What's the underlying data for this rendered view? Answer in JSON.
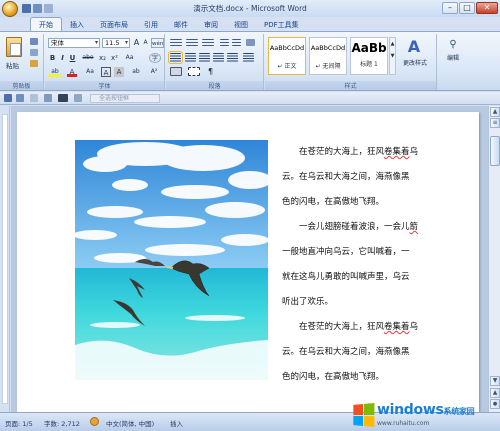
{
  "window": {
    "title": "演示文档.docx - Microsoft Word",
    "minimize": "–",
    "maximize": "□",
    "close": "✕"
  },
  "tabs": [
    "开始",
    "插入",
    "页面布局",
    "引用",
    "邮件",
    "审阅",
    "视图",
    "PDF工具集"
  ],
  "ribbon": {
    "clipboard": {
      "paste": "粘贴",
      "label": "剪贴板"
    },
    "font": {
      "font_name": "宋体",
      "font_size": "11.5",
      "label": "字体",
      "bold": "B",
      "italic": "I",
      "underline": "U",
      "strike": "abe",
      "sub": "x₂",
      "sup": "x²",
      "grow": "A",
      "shrink": "A",
      "clear": "Aa",
      "highlight": "ab",
      "color": "A",
      "phonetic": "wén",
      "border": "A",
      "charshade": "A",
      "case": "Aa",
      "circle": "字"
    },
    "paragraph": {
      "label": "段落"
    },
    "styles": {
      "label": "样式",
      "items": [
        {
          "sample": "AaBbCcDd",
          "name": "↵ 正文"
        },
        {
          "sample": "AaBbCcDd",
          "name": "↵ 无间隔"
        },
        {
          "sample": "AaBb",
          "name": "标题 1"
        }
      ],
      "change": "更改样式"
    },
    "editing": {
      "label": "编辑"
    }
  },
  "qat": {
    "field_placeholder": "全选按钮框"
  },
  "document": {
    "lines": [
      {
        "text_a": "在苍茫的大海上，狂风",
        "text_b": "卷集着",
        "text_c": "乌",
        "indent": true
      },
      {
        "text_a": "云。在乌云和大海之间，海燕像黑",
        "indent": false
      },
      {
        "text_a": "色的闪电，在高傲地飞翔。",
        "indent": false
      },
      {
        "text_a": "一会儿翅膀碰着波浪，一会儿",
        "text_b": "箭",
        "indent": true
      },
      {
        "text_a": "一般地直冲向乌云，它叫喊着，一",
        "indent": false
      },
      {
        "text_a": "就在这鸟儿勇敢的叫喊声里，乌云",
        "indent": false
      },
      {
        "text_a": "听出了欢乐。",
        "indent": false
      },
      {
        "text_a": "在苍茫的大海上，狂风",
        "text_b": "卷集着",
        "text_c": "乌",
        "indent": true
      },
      {
        "text_a": "云。在乌云和大海之间，海燕像黑",
        "indent": false
      },
      {
        "text_a": "色的闪电，在高傲地飞翔。",
        "indent": false
      }
    ]
  },
  "status": {
    "page": "页面: 1/5",
    "words": "字数: 2,712",
    "lang": "中文(简体, 中国)",
    "mode": "插入"
  },
  "watermark": {
    "brand": "windows",
    "brand_suffix": "系统家园",
    "site": "www.ruhaitu.com"
  },
  "colors": {
    "ribbon_blue": "#c9daf2",
    "accent": "#15428b",
    "squiggle": "#e23c3c",
    "sea_top": "#3fd0e0",
    "sky": "#5aa6e6"
  }
}
